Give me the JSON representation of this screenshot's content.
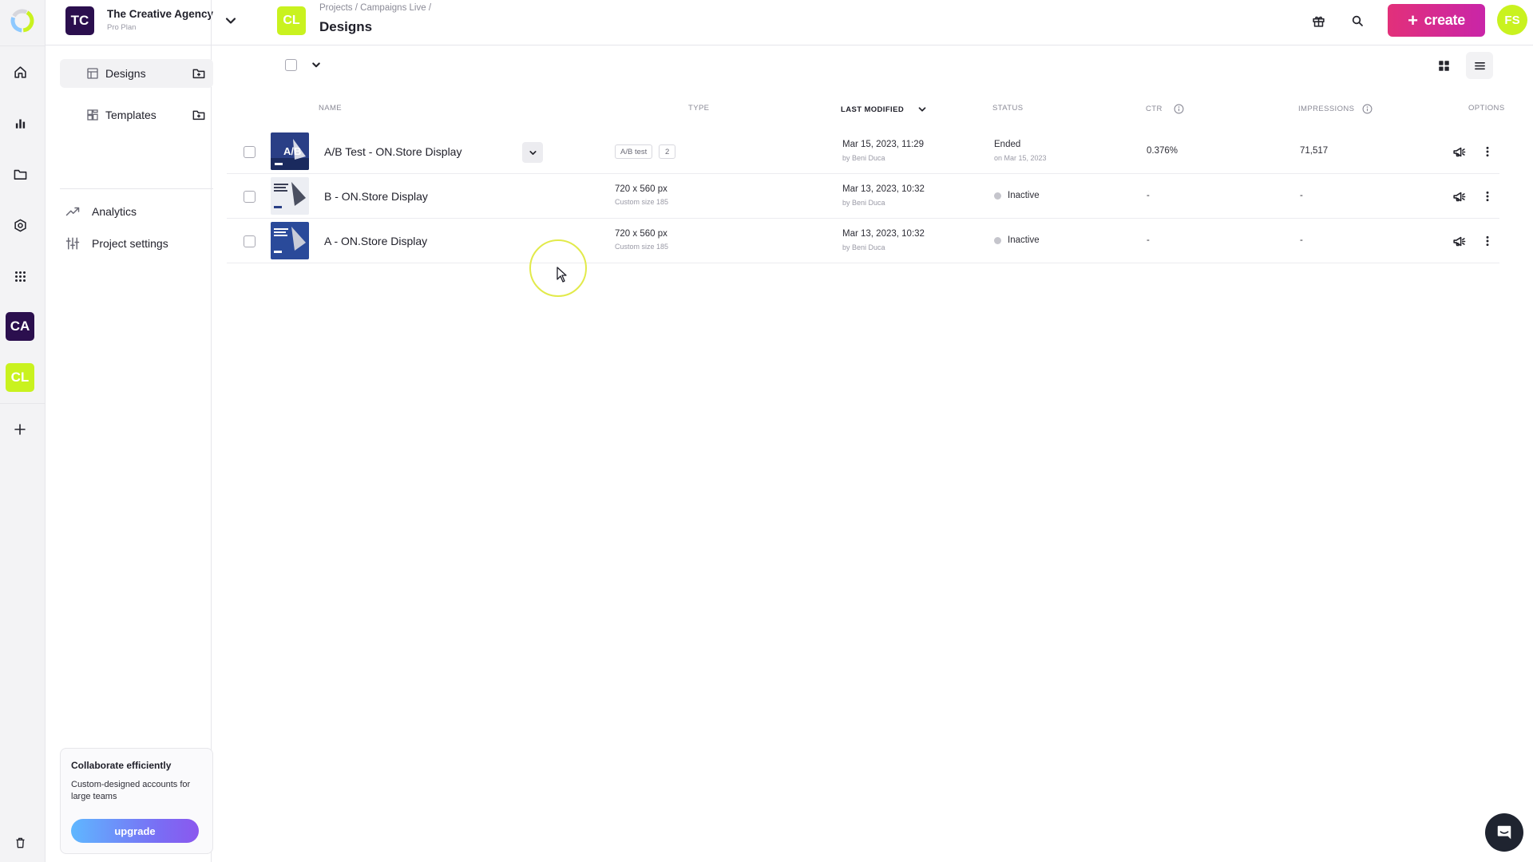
{
  "rail": {
    "org_badge": "CA",
    "project_badge": "CL",
    "colors": {
      "org_badge_bg": "#2b0f4e",
      "project_badge_bg": "#c9f21f"
    }
  },
  "header": {
    "org_initials": "TC",
    "org_name": "The Creative Agency",
    "org_plan": "Pro Plan",
    "project_initials": "CL",
    "breadcrumb": [
      "Projects",
      "Campaigns Live"
    ],
    "breadcrumb_separator": "/",
    "title": "Designs",
    "create_label": "create",
    "user_initials": "FS",
    "colors": {
      "create_gradient_start": "#e2307a",
      "create_gradient_end": "#c925a8",
      "user_avatar_bg": "#c9f21f"
    }
  },
  "sidebar": {
    "items": [
      {
        "label": "Designs",
        "icon": "layout-icon",
        "active": true
      },
      {
        "label": "Templates",
        "icon": "templates-icon",
        "active": false
      }
    ],
    "links": [
      {
        "label": "Analytics",
        "icon": "trending-up-icon"
      },
      {
        "label": "Project settings",
        "icon": "sliders-icon"
      }
    ],
    "promo": {
      "title": "Collaborate efficiently",
      "text": "Custom-designed accounts for large teams",
      "button": "upgrade"
    }
  },
  "table": {
    "columns": {
      "name": "NAME",
      "type": "TYPE",
      "last_modified": "LAST MODIFIED",
      "status": "STATUS",
      "ctr": "CTR",
      "impressions": "IMPRESSIONS",
      "options": "OPTIONS"
    },
    "rows": [
      {
        "name": "A/B Test - ON.Store Display",
        "type_tag": "A/B test",
        "type_count": "2",
        "modified": "Mar 15, 2023, 11:29",
        "modified_by": "by Beni Duca",
        "status": "Ended",
        "status_sub": "on Mar 15, 2023",
        "ctr": "0.376%",
        "impressions": "71,517"
      },
      {
        "name": "B - ON.Store Display",
        "type": "720 x 560 px",
        "type_sub": "Custom size 185",
        "modified": "Mar 13, 2023, 10:32",
        "modified_by": "by Beni Duca",
        "status": "Inactive",
        "ctr": "-",
        "impressions": "-"
      },
      {
        "name": "A - ON.Store Display",
        "type": "720 x 560 px",
        "type_sub": "Custom size 185",
        "modified": "Mar 13, 2023, 10:32",
        "modified_by": "by Beni Duca",
        "status": "Inactive",
        "ctr": "-",
        "impressions": "-"
      }
    ]
  }
}
